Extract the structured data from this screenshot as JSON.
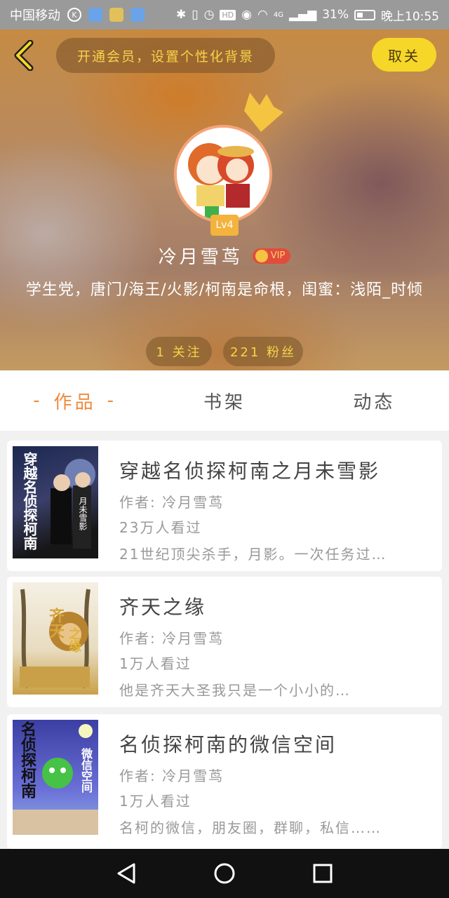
{
  "status_bar": {
    "carrier": "中国移动",
    "network": "4G",
    "battery": "31%",
    "time": "晚上10:55"
  },
  "header": {
    "member_banner": "开通会员，设置个性化背景",
    "unfollow_label": "取关",
    "level": "Lv4",
    "username": "冷月雪茑",
    "vip_label": "VIP",
    "bio": "学生党，唐门/海王/火影/柯南是命根，闺蜜：浅陌_时倾",
    "following": "1 关注",
    "fans": "221 粉丝"
  },
  "tabs": [
    {
      "label": "作品",
      "dash": "-",
      "active": true
    },
    {
      "label": "书架",
      "active": false
    },
    {
      "label": "动态",
      "active": false
    }
  ],
  "books": [
    {
      "title": "穿越名侦探柯南之月未雪影",
      "author": "作者: 冷月雪茑",
      "views": "23万人看过",
      "desc": "21世纪顶尖杀手，月影。一次任务过…",
      "cover_text": "穿越名侦探柯南",
      "cover_sub": "月未雪影"
    },
    {
      "title": "齐天之缘",
      "author": "作者: 冷月雪茑",
      "views": "1万人看过",
      "desc": "他是齐天大圣我只是一个小小的…",
      "cover_text": "齐天",
      "cover_sub": "之缘"
    },
    {
      "title": "名侦探柯南的微信空间",
      "author": "作者: 冷月雪茑",
      "views": "1万人看过",
      "desc": "名柯的微信，朋友圈，群聊，私信……",
      "cover_text": "名侦探柯南",
      "cover_sub": "微信空间"
    }
  ],
  "icons": {
    "back": "chevron-left-icon",
    "crown": "crown-icon",
    "nav_back": "triangle-back-icon",
    "nav_home": "circle-home-icon",
    "nav_recent": "square-recent-icon"
  },
  "colors": {
    "accent": "#ef8a3c",
    "yellow": "#f6d628",
    "banner_text": "#f7d44a"
  }
}
